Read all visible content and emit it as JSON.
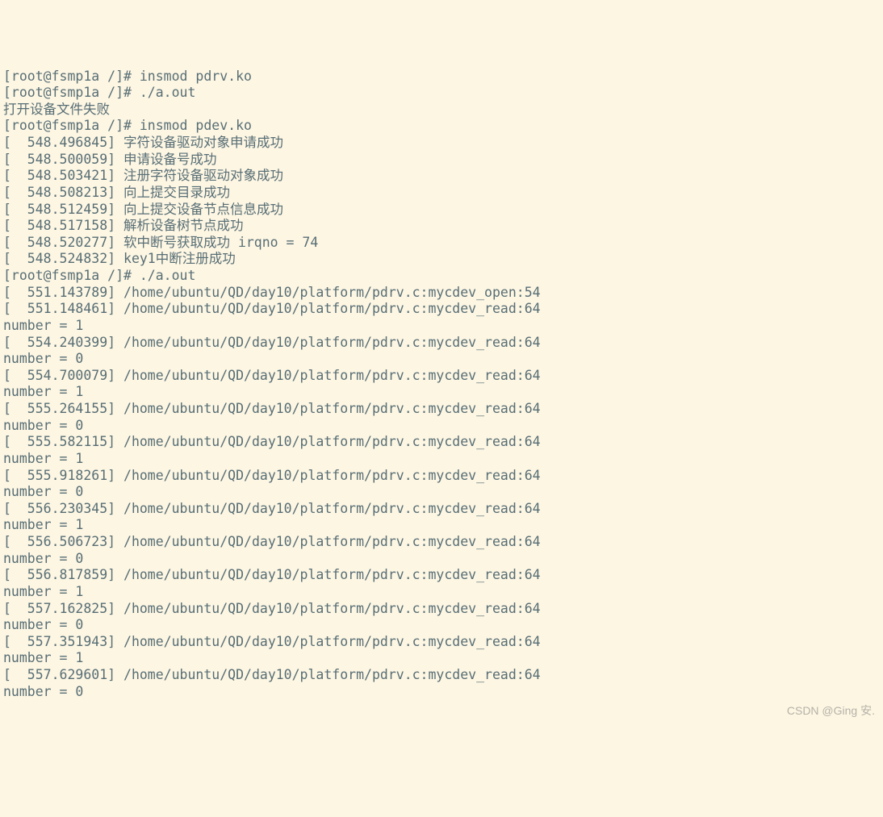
{
  "lines": [
    "[root@fsmp1a /]# insmod pdrv.ko",
    "[root@fsmp1a /]# ./a.out",
    "打开设备文件失败",
    "[root@fsmp1a /]# insmod pdev.ko",
    "[  548.496845] 字符设备驱动对象申请成功",
    "[  548.500059] 申请设备号成功",
    "[  548.503421] 注册字符设备驱动对象成功",
    "[  548.508213] 向上提交目录成功",
    "[  548.512459] 向上提交设备节点信息成功",
    "[  548.517158] 解析设备树节点成功",
    "[  548.520277] 软中断号获取成功 irqno = 74",
    "[  548.524832] key1中断注册成功",
    "[root@fsmp1a /]# ./a.out",
    "[  551.143789] /home/ubuntu/QD/day10/platform/pdrv.c:mycdev_open:54",
    "[  551.148461] /home/ubuntu/QD/day10/platform/pdrv.c:mycdev_read:64",
    "number = 1",
    "[  554.240399] /home/ubuntu/QD/day10/platform/pdrv.c:mycdev_read:64",
    "number = 0",
    "[  554.700079] /home/ubuntu/QD/day10/platform/pdrv.c:mycdev_read:64",
    "number = 1",
    "[  555.264155] /home/ubuntu/QD/day10/platform/pdrv.c:mycdev_read:64",
    "number = 0",
    "[  555.582115] /home/ubuntu/QD/day10/platform/pdrv.c:mycdev_read:64",
    "number = 1",
    "[  555.918261] /home/ubuntu/QD/day10/platform/pdrv.c:mycdev_read:64",
    "number = 0",
    "[  556.230345] /home/ubuntu/QD/day10/platform/pdrv.c:mycdev_read:64",
    "number = 1",
    "[  556.506723] /home/ubuntu/QD/day10/platform/pdrv.c:mycdev_read:64",
    "number = 0",
    "[  556.817859] /home/ubuntu/QD/day10/platform/pdrv.c:mycdev_read:64",
    "number = 1",
    "[  557.162825] /home/ubuntu/QD/day10/platform/pdrv.c:mycdev_read:64",
    "number = 0",
    "[  557.351943] /home/ubuntu/QD/day10/platform/pdrv.c:mycdev_read:64",
    "number = 1",
    "[  557.629601] /home/ubuntu/QD/day10/platform/pdrv.c:mycdev_read:64",
    "number = 0"
  ],
  "watermark": "CSDN @Ging 安."
}
